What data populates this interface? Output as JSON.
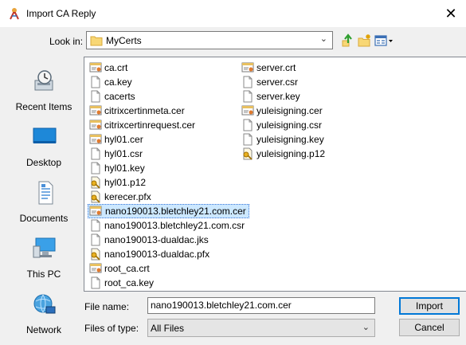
{
  "window": {
    "title": "Import CA Reply",
    "close_glyph": "✕"
  },
  "look_in": {
    "label": "Look in:",
    "value": "MyCerts"
  },
  "toolbar": {
    "icons": [
      "up-one-level-icon",
      "new-folder-icon",
      "view-menu-icon"
    ]
  },
  "places": [
    {
      "label": "Recent Items",
      "icon": "recent-items-icon"
    },
    {
      "label": "Desktop",
      "icon": "desktop-icon"
    },
    {
      "label": "Documents",
      "icon": "documents-icon"
    },
    {
      "label": "This PC",
      "icon": "this-pc-icon"
    },
    {
      "label": "Network",
      "icon": "network-icon"
    }
  ],
  "files": [
    {
      "name": "ca.crt",
      "type": "cert",
      "selected": false
    },
    {
      "name": "ca.key",
      "type": "file",
      "selected": false
    },
    {
      "name": "cacerts",
      "type": "file",
      "selected": false
    },
    {
      "name": "citrixcertinmeta.cer",
      "type": "cert",
      "selected": false
    },
    {
      "name": "citrixcertinrequest.cer",
      "type": "cert",
      "selected": false
    },
    {
      "name": "hyl01.cer",
      "type": "cert",
      "selected": false
    },
    {
      "name": "hyl01.csr",
      "type": "file",
      "selected": false
    },
    {
      "name": "hyl01.key",
      "type": "file",
      "selected": false
    },
    {
      "name": "hyl01.p12",
      "type": "pfx",
      "selected": false
    },
    {
      "name": "kerecer.pfx",
      "type": "pfx",
      "selected": false
    },
    {
      "name": "nano190013.bletchley21.com.cer",
      "type": "cert",
      "selected": true
    },
    {
      "name": "nano190013.bletchley21.com.csr",
      "type": "file",
      "selected": false
    },
    {
      "name": "nano190013-dualdac.jks",
      "type": "file",
      "selected": false
    },
    {
      "name": "nano190013-dualdac.pfx",
      "type": "pfx",
      "selected": false
    },
    {
      "name": "root_ca.crt",
      "type": "cert",
      "selected": false
    },
    {
      "name": "root_ca.key",
      "type": "file",
      "selected": false
    },
    {
      "name": "server.crt",
      "type": "cert",
      "selected": false
    },
    {
      "name": "server.csr",
      "type": "file",
      "selected": false
    },
    {
      "name": "server.key",
      "type": "file",
      "selected": false
    },
    {
      "name": "yuleisigning.cer",
      "type": "cert",
      "selected": false
    },
    {
      "name": "yuleisigning.csr",
      "type": "file",
      "selected": false
    },
    {
      "name": "yuleisigning.key",
      "type": "file",
      "selected": false
    },
    {
      "name": "yuleisigning.p12",
      "type": "pfx",
      "selected": false
    }
  ],
  "file_name": {
    "label": "File name:",
    "value": "nano190013.bletchley21.com.cer"
  },
  "files_of_type": {
    "label": "Files of type:",
    "value": "All Files"
  },
  "buttons": {
    "import": "Import",
    "cancel": "Cancel"
  }
}
